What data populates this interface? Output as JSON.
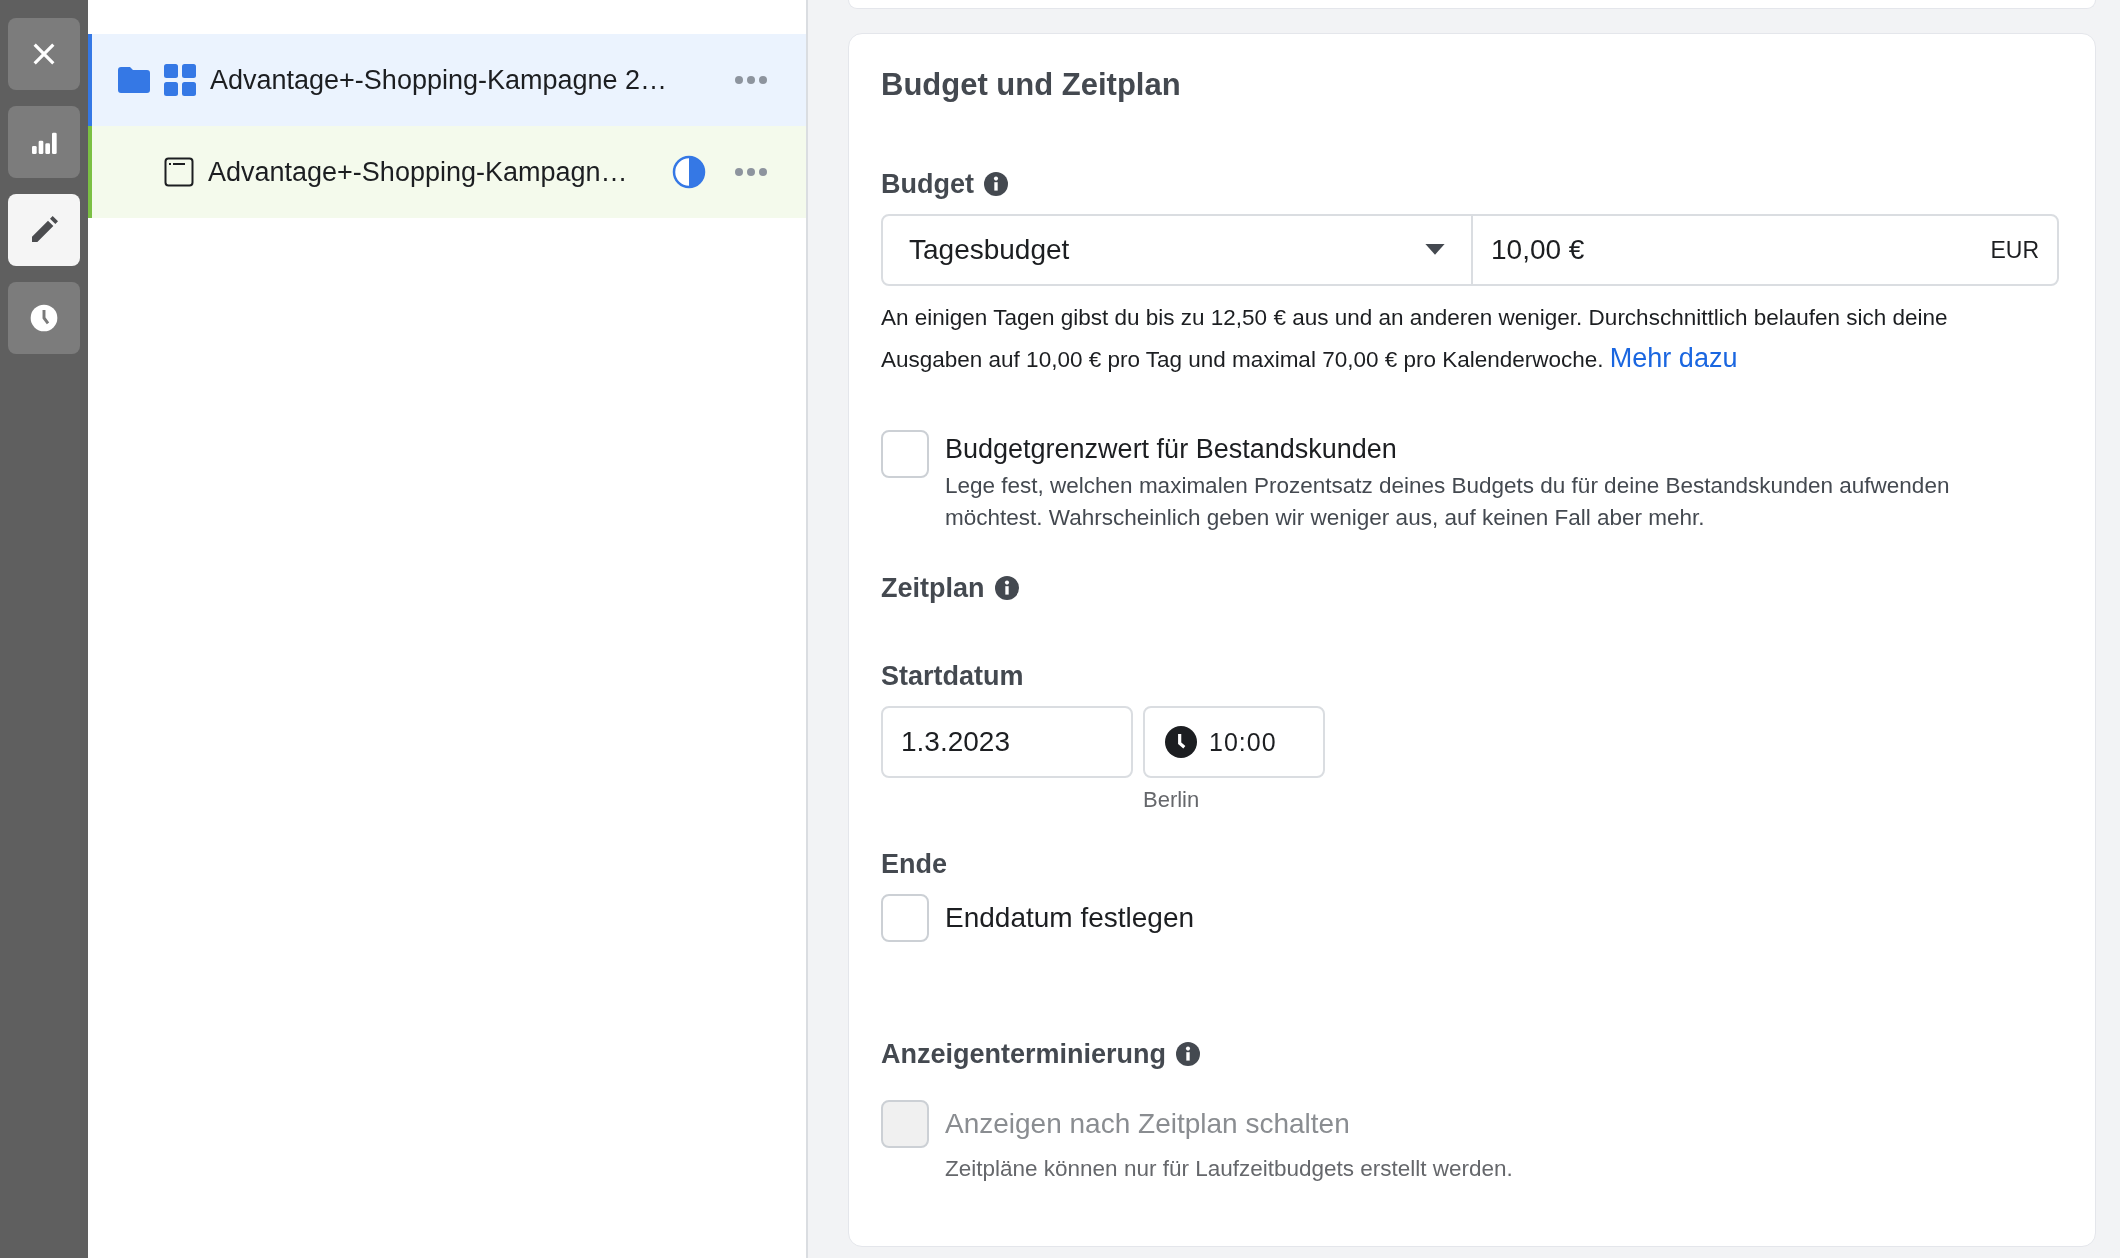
{
  "rail": [
    {
      "kind": "close",
      "selected": false
    },
    {
      "kind": "chart",
      "selected": false
    },
    {
      "kind": "edit",
      "selected": true
    },
    {
      "kind": "clock",
      "selected": false
    }
  ],
  "tree": [
    {
      "kind": "campaign",
      "label": "Advantage+-Shopping-Kampagne 2…",
      "selected": true
    },
    {
      "kind": "ad_set",
      "label": "Advantage+-Shopping-Kampagn…",
      "selected": false
    }
  ],
  "section_title": "Budget und Zeitplan",
  "budget": {
    "label": "Budget",
    "type_select": {
      "value": "Tagesbudget"
    },
    "amount": {
      "value": "10,00 €",
      "currency": "EUR"
    },
    "note": "An einigen Tagen gibst du bis zu 12,50 € aus und an anderen weniger. Durchschnittlich belaufen sich deine Ausgaben auf 10,00 € pro Tag und maximal 70,00 € pro Kalenderwoche.",
    "link": "Mehr dazu"
  },
  "options": [
    {
      "label": "Budgetgrenzwert für Bestandskunden",
      "description": "Lege fest, welchen maximalen Prozentsatz deines Budgets du für deine Bestandskunden aufwenden möchtest. Wahrscheinlich geben wir weniger aus, auf keinen Fall aber mehr.",
      "checked": false
    }
  ],
  "schedule": {
    "label": "Zeitplan",
    "start": {
      "label": "Startdatum",
      "date": "1.3.2023",
      "time": "10:00",
      "timezone": "Berlin"
    },
    "end": {
      "label": "Ende",
      "checkbox": {
        "label": "Enddatum festlegen",
        "checked": false
      }
    }
  },
  "ad_scheduling": {
    "label": "Anzeigenterminierung",
    "checkbox": {
      "label": "Anzeigen nach Zeitplan schalten",
      "checked": false,
      "disabled": true
    },
    "hint": "Zeitpläne können nur für Laufzeitbudgets erstellt werden."
  }
}
